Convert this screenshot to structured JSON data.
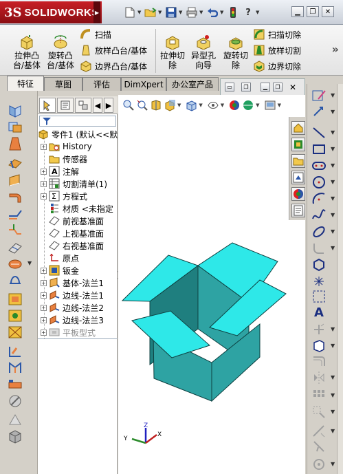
{
  "app": {
    "logo_ds": "3S",
    "logo_name": "SOLIDWORKS"
  },
  "ribbon": {
    "extrude_boss": "拉伸凸台/基体",
    "revolve_boss": "旋转凸台/基体",
    "sweep": "扫描",
    "loft_boss": "放样凸台/基体",
    "boundary_boss": "边界凸台/基体",
    "extrude_cut": "拉伸切除",
    "hole_wizard": "异型孔向导",
    "revolve_cut": "旋转切除",
    "sweep_cut": "扫描切除",
    "loft_cut": "放样切割",
    "boundary_cut": "边界切除"
  },
  "tabs": [
    "特征",
    "草图",
    "评估",
    "DimXpert",
    "办公室产品"
  ],
  "tree": {
    "root": "零件1 (默认<<默",
    "items": [
      {
        "label": "History",
        "expandable": true
      },
      {
        "label": "传感器",
        "expandable": false
      },
      {
        "label": "注解",
        "expandable": true
      },
      {
        "label": "切割清单(1)",
        "expandable": true
      },
      {
        "label": "方程式",
        "expandable": true
      },
      {
        "label": "材质 <未指定",
        "expandable": false
      },
      {
        "label": "前视基准面",
        "expandable": false
      },
      {
        "label": "上视基准面",
        "expandable": false
      },
      {
        "label": "右视基准面",
        "expandable": false
      },
      {
        "label": "原点",
        "expandable": false
      },
      {
        "label": "钣金",
        "expandable": true
      },
      {
        "label": "基体-法兰1",
        "expandable": true
      },
      {
        "label": "边线-法兰1",
        "expandable": true
      },
      {
        "label": "边线-法兰2",
        "expandable": true
      },
      {
        "label": "边线-法兰3",
        "expandable": true
      },
      {
        "label": "平板型式",
        "expandable": true
      }
    ]
  },
  "axis": {
    "x": "X",
    "y": "Y",
    "z": "Z"
  },
  "colors": {
    "box_face": "#2ea3a3",
    "box_flap": "#2ee8e8",
    "brand_red": "#b3161d"
  }
}
